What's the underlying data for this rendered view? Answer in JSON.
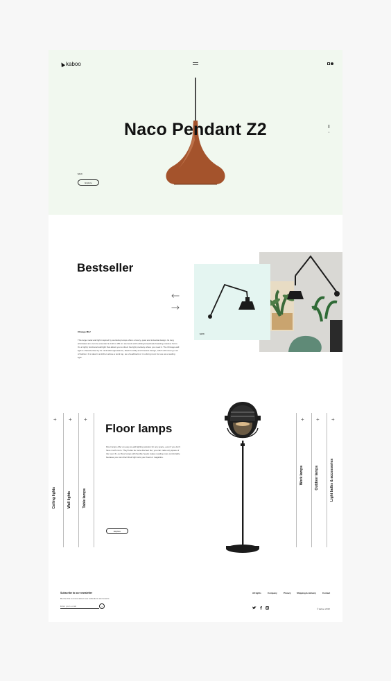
{
  "header": {
    "logo": "kaboo",
    "menu_icon": "hamburger-icon",
    "cart_icon": "cart-icon"
  },
  "hero": {
    "title": "Naco Pendant Z2",
    "price": "$419",
    "explore_label": "Explore",
    "colors": {
      "background": "#f1f8ef",
      "lamp": "#a4532c"
    }
  },
  "bestseller": {
    "title": "Bestseller",
    "product_name": "Chicago ML2",
    "description": "This large metal wall light inspired by workshop lamps offers a luxury, quiet and industrial design. Its long articulated arm can be extended to 102 to 150 cm and ends with a tilting lampshade boasting massive forms. It's a highly functional wall light that allows you to direct the light precisely where you need it. The Chicago wall light is characterized by its minimalist appearance, black humility and timeless design, which will never go out of fashion. It is ideal in a kitchen above a work top, as a headboard or in a living room for use as a reading light.",
    "price": "$258",
    "prev_icon": "arrow-left-icon",
    "next_icon": "arrow-right-icon",
    "card_color": "#e4f5f1"
  },
  "floor": {
    "title": "Floor lamps",
    "description": "Floor lamps offer an easy-to-add lighting solution for any space, even if you don't have much room. They'll also be more discreet but, you can make any space of the room fit, our floor lamps with flexible heads makes reading more comfortable because you can direct their light onto your book or magazine.",
    "explore_label": "Explore",
    "left_categories": [
      "Ceiling lights",
      "Wall lights",
      "Table lamps"
    ],
    "right_categories": [
      "Work lamps",
      "Outdoor lamps",
      "Light bulbs & accessories"
    ],
    "plus_icon": "+"
  },
  "footer": {
    "newsletter_title": "Subscribe to our newsletter",
    "newsletter_sub": "Be the first to know about new collections and events",
    "email_placeholder": "Enter your e-mail",
    "submit_glyph": "›",
    "nav": [
      "All lights",
      "Company",
      "Privacy",
      "Shipping & delivery",
      "Contact"
    ],
    "social": [
      "twitter-icon",
      "facebook-icon",
      "instagram-icon"
    ],
    "copyright": "© kaboo 2018"
  }
}
